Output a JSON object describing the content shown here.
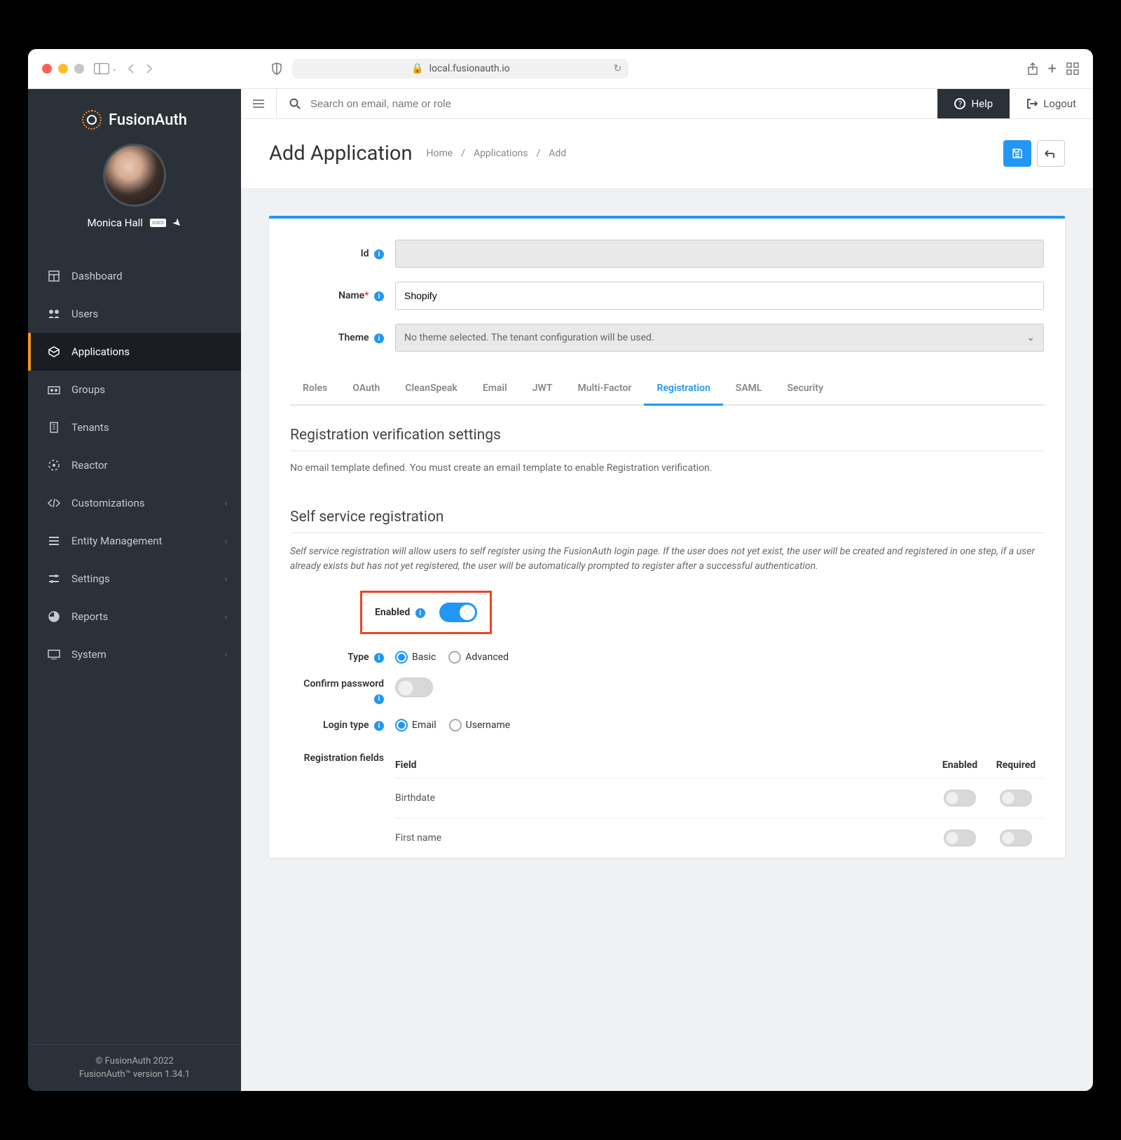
{
  "browser": {
    "url": "local.fusionauth.io"
  },
  "brand": "FusionAuth",
  "user": {
    "name": "Monica Hall"
  },
  "topbar": {
    "search_placeholder": "Search on email, name or role",
    "help": "Help",
    "logout": "Logout"
  },
  "sidebar": {
    "items": [
      {
        "label": "Dashboard",
        "icon": "dashboard"
      },
      {
        "label": "Users",
        "icon": "users"
      },
      {
        "label": "Applications",
        "icon": "apps",
        "active": true
      },
      {
        "label": "Groups",
        "icon": "groups"
      },
      {
        "label": "Tenants",
        "icon": "tenants"
      },
      {
        "label": "Reactor",
        "icon": "reactor"
      },
      {
        "label": "Customizations",
        "icon": "code",
        "expandable": true
      },
      {
        "label": "Entity Management",
        "icon": "entity",
        "expandable": true
      },
      {
        "label": "Settings",
        "icon": "settings",
        "expandable": true
      },
      {
        "label": "Reports",
        "icon": "reports",
        "expandable": true
      },
      {
        "label": "System",
        "icon": "system",
        "expandable": true
      }
    ]
  },
  "footer": {
    "copyright": "© FusionAuth 2022",
    "version": "FusionAuth™ version 1.34.1"
  },
  "page": {
    "title": "Add Application",
    "breadcrumb": [
      "Home",
      "Applications",
      "Add"
    ]
  },
  "form": {
    "id_label": "Id",
    "id_value": "",
    "name_label": "Name",
    "name_value": "Shopify",
    "theme_label": "Theme",
    "theme_value": "No theme selected. The tenant configuration will be used."
  },
  "tabs": [
    "Roles",
    "OAuth",
    "CleanSpeak",
    "Email",
    "JWT",
    "Multi-Factor",
    "Registration",
    "SAML",
    "Security"
  ],
  "active_tab": "Registration",
  "sections": {
    "reg_verify": {
      "title": "Registration verification settings",
      "text": "No email template defined. You must create an email template to enable Registration verification."
    },
    "self_service": {
      "title": "Self service registration",
      "desc": "Self service registration will allow users to self register using the FusionAuth login page. If the user does not yet exist, the user will be created and registered in one step, if a user already exists but has not yet registered, the user will be automatically prompted to register after a successful authentication.",
      "enabled_label": "Enabled",
      "type_label": "Type",
      "type_opts": [
        "Basic",
        "Advanced"
      ],
      "confirm_label": "Confirm password",
      "login_label": "Login type",
      "login_opts": [
        "Email",
        "Username"
      ],
      "fields_label": "Registration fields",
      "field_head": "Field",
      "enabled_head": "Enabled",
      "required_head": "Required",
      "fields": [
        {
          "name": "Birthdate"
        },
        {
          "name": "First name"
        }
      ]
    }
  }
}
